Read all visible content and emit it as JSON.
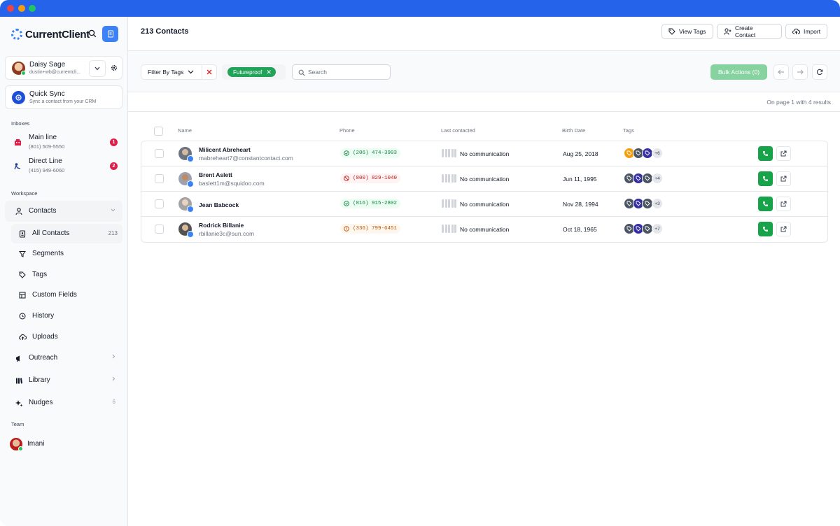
{
  "app": {
    "brand": "CurrentClient"
  },
  "user": {
    "name": "Daisy Sage",
    "email": "dustin+wb@currentcli..."
  },
  "quick_sync": {
    "title": "Quick Sync",
    "subtitle": "Sync a contact from your CRM"
  },
  "inboxes": {
    "label": "Inboxes",
    "items": [
      {
        "name": "Main line",
        "phone": "(801) 509-5550",
        "badge": "1"
      },
      {
        "name": "Direct Line",
        "phone": "(415) 949-6060",
        "badge": "2"
      }
    ]
  },
  "workspace": {
    "label": "Workspace",
    "contacts": "Contacts",
    "sub": [
      {
        "label": "All Contacts",
        "count": "213"
      },
      {
        "label": "Segments"
      },
      {
        "label": "Tags"
      },
      {
        "label": "Custom Fields"
      },
      {
        "label": "History"
      },
      {
        "label": "Uploads"
      }
    ],
    "outreach": "Outreach",
    "library": "Library",
    "nudges": "Nudges",
    "nudges_count": "6"
  },
  "team": {
    "label": "Team",
    "member": "Imani"
  },
  "header": {
    "title": "213 Contacts",
    "view_tags": "View Tags",
    "create_contact": "Create Contact",
    "import": "Import"
  },
  "toolbar": {
    "filter_label": "Filter By Tags",
    "active_tag": "Futureproof",
    "search_placeholder": "Search",
    "bulk_actions": "Bulk Actions (0)"
  },
  "results_text": "On page 1 with 4 results",
  "table": {
    "columns": [
      "Name",
      "Phone",
      "Last contacted",
      "Birth Date",
      "Tags"
    ],
    "rows": [
      {
        "name": "Milicent Abreheart",
        "email": "mabreheart7@constantcontact.com",
        "phone": "(206) 474-3903",
        "phone_status": "ok",
        "last_contacted": "No communication",
        "birth_date": "Aug 25, 2018",
        "tags_more": "+6"
      },
      {
        "name": "Brent Aslett",
        "email": "baslett1m@squidoo.com",
        "phone": "(800) 829-1040",
        "phone_status": "blocked",
        "last_contacted": "No communication",
        "birth_date": "Jun 11, 1995",
        "tags_more": "+4"
      },
      {
        "name": "Jean Babcock",
        "email": "",
        "phone": "(816) 915-2802",
        "phone_status": "ok",
        "last_contacted": "No communication",
        "birth_date": "Nov 28, 1994",
        "tags_more": "+3"
      },
      {
        "name": "Rodrick Billanie",
        "email": "rbillanie3c@sun.com",
        "phone": "(336) 799-6451",
        "phone_status": "warning",
        "last_contacted": "No communication",
        "birth_date": "Oct 18, 1965",
        "tags_more": "+7"
      }
    ]
  },
  "colors": {
    "titlebar": "#2563eb",
    "accent": "#3b82f6",
    "success": "#16a34a",
    "tag_chip": "#22a35a",
    "badge": "#e11d48"
  }
}
